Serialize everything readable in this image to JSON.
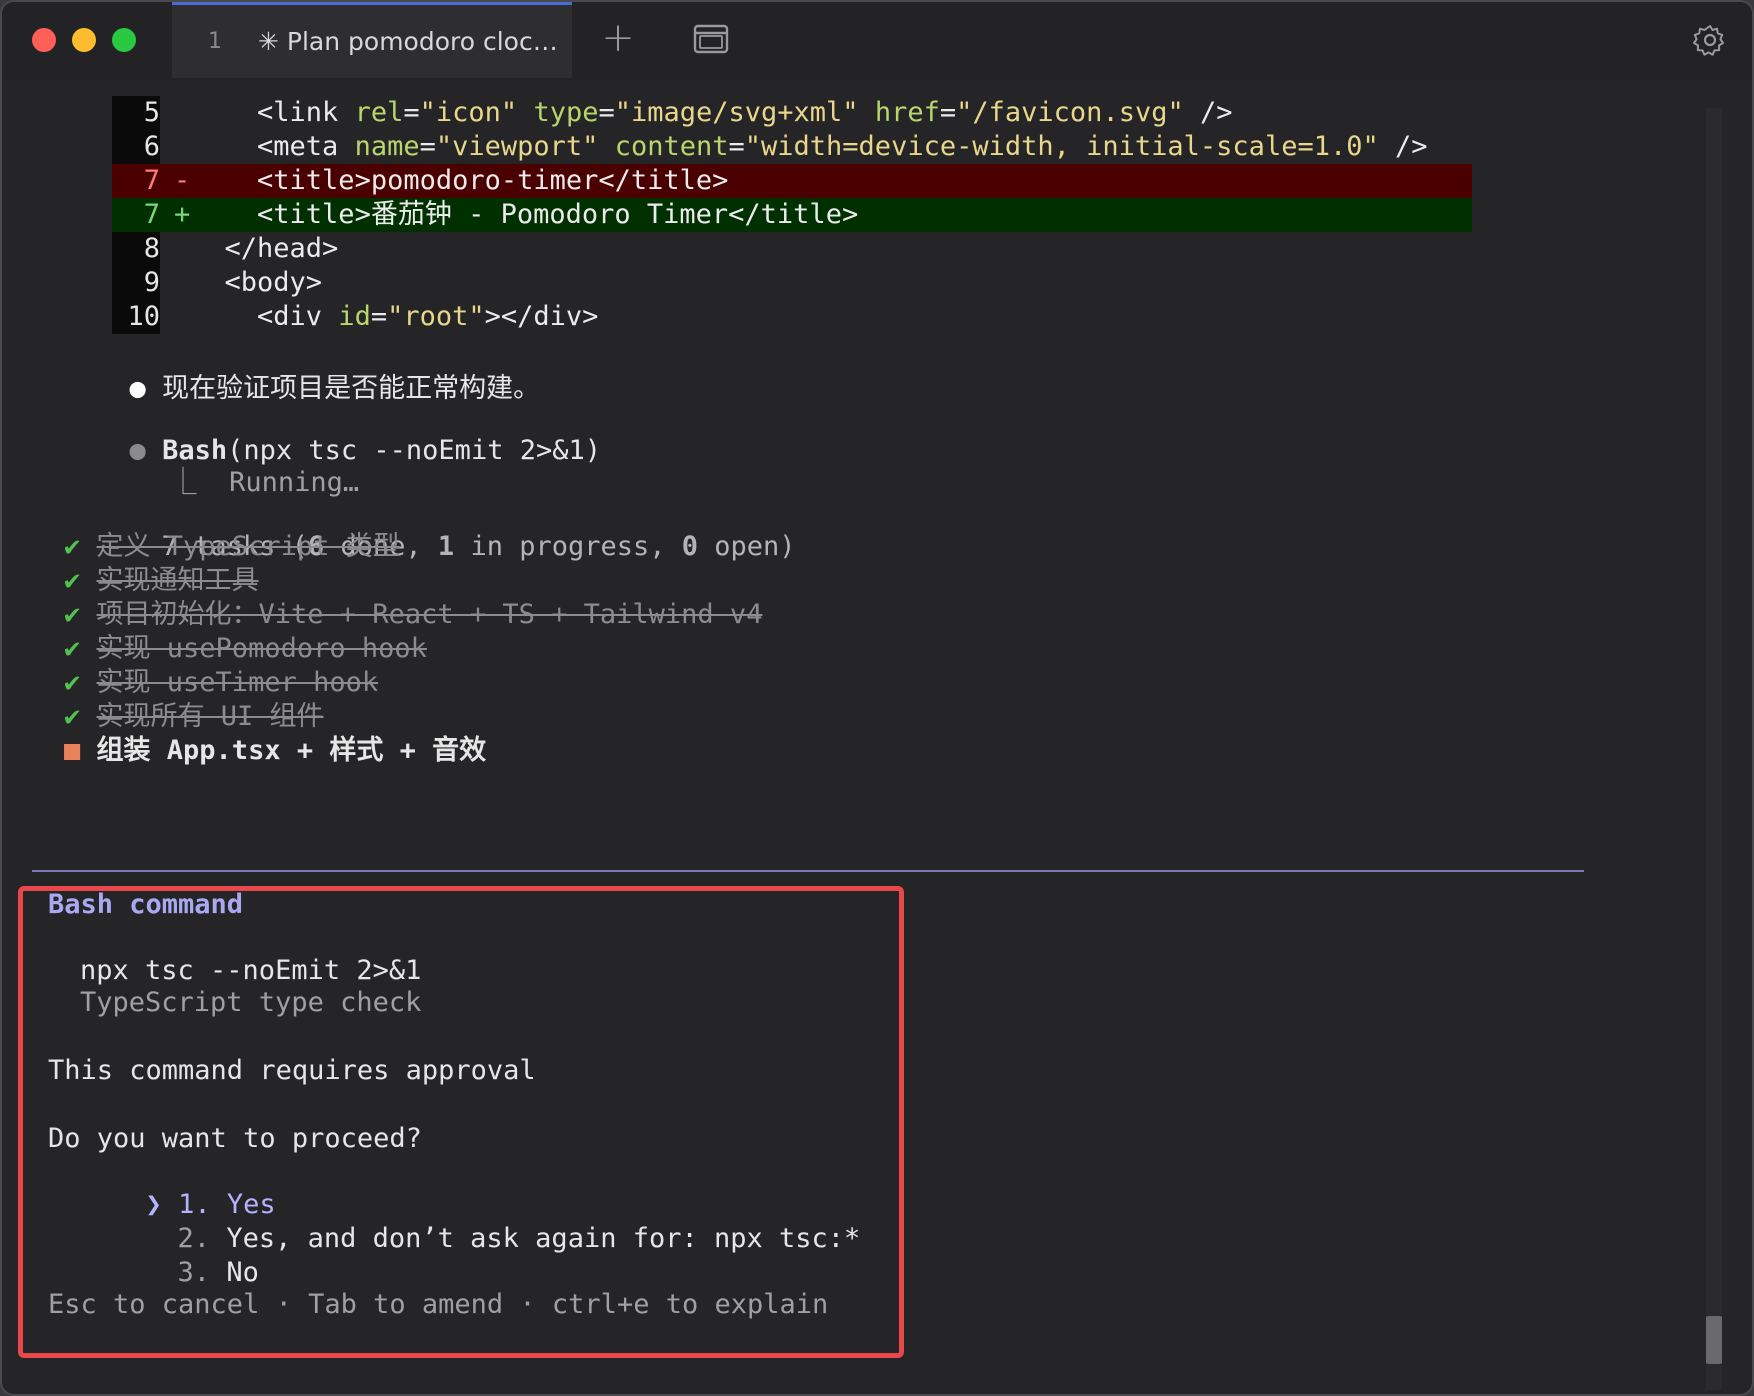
{
  "tab": {
    "number": "1",
    "title": "✳ Plan pomodoro cloc…"
  },
  "toolbar": {
    "new_tab": "+"
  },
  "diff": [
    {
      "num": "5",
      "sign": "",
      "indent": "    ",
      "parts": [
        [
          "tag",
          "<link "
        ],
        [
          "attr",
          "rel"
        ],
        [
          "tag",
          "="
        ],
        [
          "str",
          "\"icon\""
        ],
        [
          "tag",
          " "
        ],
        [
          "attr",
          "type"
        ],
        [
          "tag",
          "="
        ],
        [
          "str",
          "\"image/svg+xml\""
        ],
        [
          "tag",
          " "
        ],
        [
          "attr",
          "href"
        ],
        [
          "tag",
          "="
        ],
        [
          "str",
          "\"/favicon.svg\""
        ],
        [
          "tag",
          " />"
        ]
      ]
    },
    {
      "num": "6",
      "sign": "",
      "indent": "    ",
      "parts": [
        [
          "tag",
          "<meta "
        ],
        [
          "attr",
          "name"
        ],
        [
          "tag",
          "="
        ],
        [
          "str",
          "\"viewport\""
        ],
        [
          "tag",
          " "
        ],
        [
          "attr",
          "content"
        ],
        [
          "tag",
          "="
        ],
        [
          "str",
          "\"width=device-width, initial-scale=1.0\""
        ],
        [
          "tag",
          " />"
        ]
      ]
    },
    {
      "num": "7",
      "sign": "-",
      "indent": "    ",
      "parts": [
        [
          "tag",
          "<title>pomodoro-timer</title>"
        ]
      ]
    },
    {
      "num": "7",
      "sign": "+",
      "indent": "    ",
      "parts": [
        [
          "tag",
          "<title>番茄钟 - Pomodoro Timer</title>"
        ]
      ]
    },
    {
      "num": "8",
      "sign": "",
      "indent": "  ",
      "parts": [
        [
          "tag",
          "</head>"
        ]
      ]
    },
    {
      "num": "9",
      "sign": "",
      "indent": "  ",
      "parts": [
        [
          "tag",
          "<body>"
        ]
      ]
    },
    {
      "num": "10",
      "sign": "",
      "indent": "    ",
      "parts": [
        [
          "tag",
          "<div "
        ],
        [
          "attr",
          "id"
        ],
        [
          "tag",
          "="
        ],
        [
          "str",
          "\"root\""
        ],
        [
          "tag",
          "></div>"
        ]
      ]
    }
  ],
  "message": {
    "bullet": "●",
    "text": "现在验证项目是否能正常构建。"
  },
  "bash_call": {
    "bullet": "●",
    "tool": "Bash",
    "args": "(npx tsc --noEmit 2>&1)",
    "status_prefix": "⎿",
    "status": "Running…"
  },
  "tasks": {
    "summary_pre": "7 tasks (",
    "done_count": "6",
    "done_label": " done, ",
    "progress_count": "1",
    "progress_label": " in progress, ",
    "open_count": "0",
    "open_label": " open)",
    "items": [
      {
        "mark": "✔",
        "text": "定义 TypeScript 类型",
        "done": true
      },
      {
        "mark": "✔",
        "text": "实现通知工具",
        "done": true
      },
      {
        "mark": "✔",
        "text": "项目初始化：Vite + React + TS + Tailwind v4",
        "done": true
      },
      {
        "mark": "✔",
        "text": "实现 usePomodoro hook",
        "done": true
      },
      {
        "mark": "✔",
        "text": "实现 useTimer hook",
        "done": true
      },
      {
        "mark": "✔",
        "text": "实现所有 UI 组件",
        "done": true
      },
      {
        "mark": "■",
        "text": "组装 App.tsx + 样式 + 音效",
        "done": false
      }
    ]
  },
  "prompt": {
    "title": "Bash command",
    "command": "npx tsc --noEmit 2>&1",
    "description": "TypeScript type check",
    "approval": "This command requires approval",
    "question": "Do you want to proceed?",
    "cursor": "❯",
    "options": [
      {
        "num": "1.",
        "label": "Yes"
      },
      {
        "num": "2.",
        "label": "Yes, and don’t ask again for: npx tsc:*"
      },
      {
        "num": "3.",
        "label": "No"
      }
    ],
    "footer": "Esc to cancel · Tab to amend · ctrl+e to explain"
  }
}
